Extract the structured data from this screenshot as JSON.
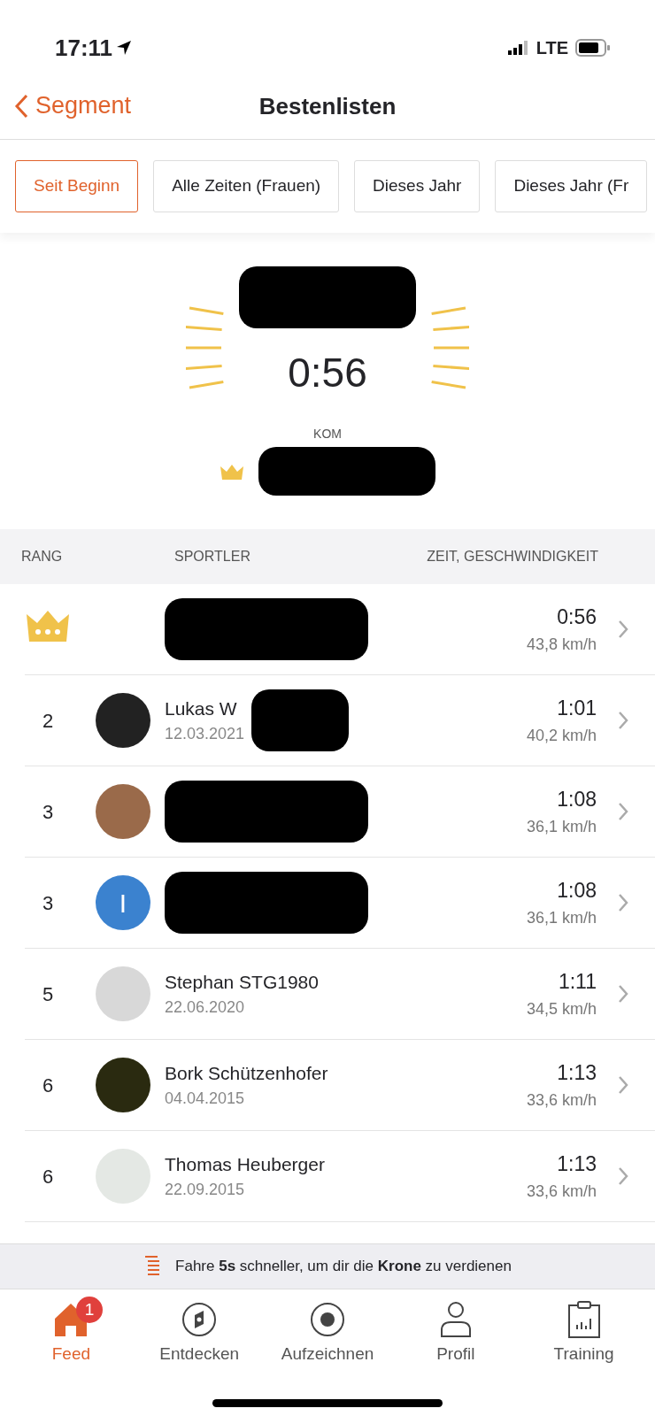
{
  "status_bar": {
    "time": "17:11",
    "network": "LTE"
  },
  "nav": {
    "back": "Segment",
    "title": "Bestenlisten"
  },
  "filters": [
    {
      "label": "Seit Beginn",
      "selected": true
    },
    {
      "label": "Alle Zeiten (Frauen)",
      "selected": false
    },
    {
      "label": "Dieses Jahr",
      "selected": false
    },
    {
      "label": "Dieses Jahr (Fr",
      "selected": false
    }
  ],
  "hero": {
    "time": "0:56",
    "caption": "KOM",
    "name_redacted": true
  },
  "table": {
    "columns": [
      "RANG",
      "SPORTLER",
      "ZEIT, GESCHWINDIGKEIT"
    ],
    "rows": [
      {
        "kind": "crown",
        "time": "0:56",
        "speed": "43,8 km/h",
        "redacted": true
      },
      {
        "kind": "rank",
        "rank": "2",
        "name": "Lukas W",
        "date": "12.03.2021",
        "time": "1:01",
        "speed": "40,2 km/h",
        "redacted": true
      },
      {
        "kind": "rank",
        "rank": "3",
        "time": "1:08",
        "speed": "36,1 km/h",
        "redacted": true
      },
      {
        "kind": "rank",
        "rank": "3",
        "avatar_letter": "I",
        "time": "1:08",
        "speed": "36,1 km/h",
        "redacted": true
      },
      {
        "kind": "rank",
        "rank": "5",
        "name": "Stephan STG1980",
        "date": "22.06.2020",
        "time": "1:11",
        "speed": "34,5 km/h",
        "redacted": false
      },
      {
        "kind": "rank",
        "rank": "6",
        "name": "Bork Schützenhofer",
        "date": "04.04.2015",
        "time": "1:13",
        "speed": "33,6 km/h",
        "redacted": false
      },
      {
        "kind": "rank",
        "rank": "6",
        "name": "Thomas Heuberger",
        "date": "22.09.2015",
        "time": "1:13",
        "speed": "33,6 km/h",
        "redacted": false
      }
    ]
  },
  "banner": "Fahre **5s** schneller, um dir die **Krone** zu verdienen",
  "tab_bar": [
    {
      "label": "Feed",
      "selected": true,
      "badge": "1"
    },
    {
      "label": "Entdecken",
      "selected": false
    },
    {
      "label": "Aufzeichnen",
      "selected": false
    },
    {
      "label": "Profil",
      "selected": false
    },
    {
      "label": "Training",
      "selected": false
    }
  ]
}
